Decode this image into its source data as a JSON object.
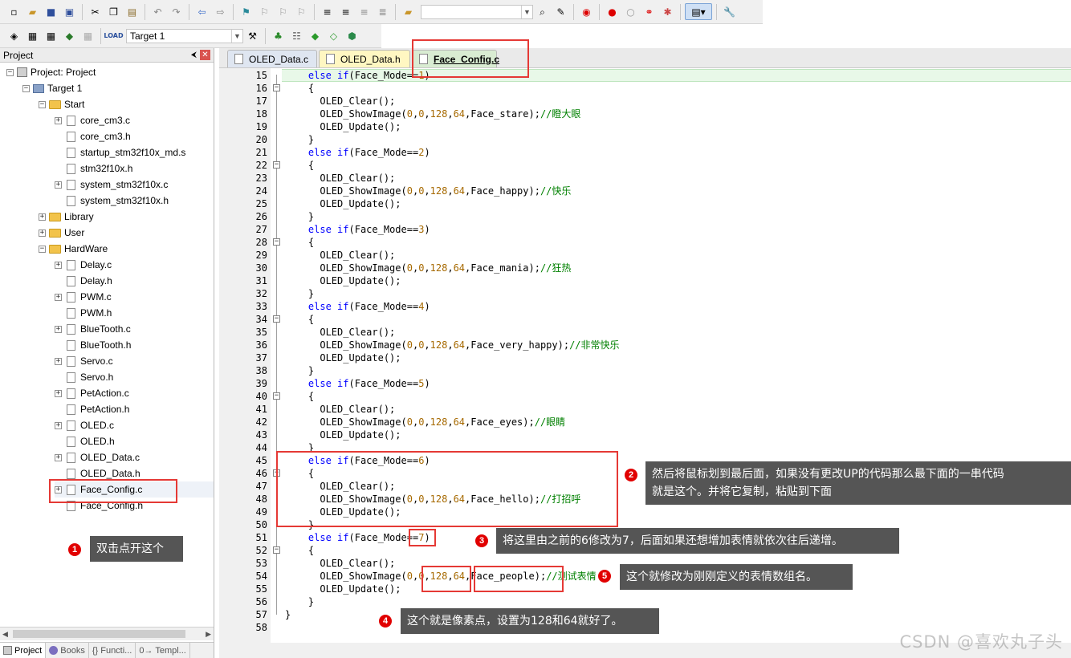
{
  "toolbar": {
    "target_select": "Target 1"
  },
  "project_panel": {
    "title": "Project",
    "pin_glyph": "⮜",
    "close_glyph": "✕",
    "tree": [
      {
        "label": "Project: Project",
        "level": 0,
        "type": "project",
        "expanded": true
      },
      {
        "label": "Target 1",
        "level": 1,
        "type": "target",
        "expanded": true
      },
      {
        "label": "Start",
        "level": 2,
        "type": "folder",
        "expanded": true
      },
      {
        "label": "core_cm3.c",
        "level": 3,
        "type": "file",
        "expandable": true
      },
      {
        "label": "core_cm3.h",
        "level": 3,
        "type": "file",
        "expandable": false
      },
      {
        "label": "startup_stm32f10x_md.s",
        "level": 3,
        "type": "file",
        "expandable": false
      },
      {
        "label": "stm32f10x.h",
        "level": 3,
        "type": "file",
        "expandable": false
      },
      {
        "label": "system_stm32f10x.c",
        "level": 3,
        "type": "file",
        "expandable": true
      },
      {
        "label": "system_stm32f10x.h",
        "level": 3,
        "type": "file",
        "expandable": false
      },
      {
        "label": "Library",
        "level": 2,
        "type": "folder",
        "expanded": false
      },
      {
        "label": "User",
        "level": 2,
        "type": "folder",
        "expanded": false
      },
      {
        "label": "HardWare",
        "level": 2,
        "type": "folder",
        "expanded": true
      },
      {
        "label": "Delay.c",
        "level": 3,
        "type": "file",
        "expandable": true
      },
      {
        "label": "Delay.h",
        "level": 3,
        "type": "file",
        "expandable": false
      },
      {
        "label": "PWM.c",
        "level": 3,
        "type": "file",
        "expandable": true
      },
      {
        "label": "PWM.h",
        "level": 3,
        "type": "file",
        "expandable": false
      },
      {
        "label": "BlueTooth.c",
        "level": 3,
        "type": "file",
        "expandable": true
      },
      {
        "label": "BlueTooth.h",
        "level": 3,
        "type": "file",
        "expandable": false
      },
      {
        "label": "Servo.c",
        "level": 3,
        "type": "file",
        "expandable": true
      },
      {
        "label": "Servo.h",
        "level": 3,
        "type": "file",
        "expandable": false
      },
      {
        "label": "PetAction.c",
        "level": 3,
        "type": "file",
        "expandable": true
      },
      {
        "label": "PetAction.h",
        "level": 3,
        "type": "file",
        "expandable": false
      },
      {
        "label": "OLED.c",
        "level": 3,
        "type": "file",
        "expandable": true
      },
      {
        "label": "OLED.h",
        "level": 3,
        "type": "file",
        "expandable": false
      },
      {
        "label": "OLED_Data.c",
        "level": 3,
        "type": "file",
        "expandable": true
      },
      {
        "label": "OLED_Data.h",
        "level": 3,
        "type": "file",
        "expandable": false
      },
      {
        "label": "Face_Config.c",
        "level": 3,
        "type": "file",
        "expandable": true,
        "selected": true
      },
      {
        "label": "Face_Config.h",
        "level": 3,
        "type": "file",
        "expandable": false
      }
    ],
    "bottom_tabs": [
      "Project",
      "Books",
      "{} Functi...",
      "0→ Templ..."
    ]
  },
  "editor": {
    "tabs": [
      {
        "label": "OLED_Data.c",
        "active": false
      },
      {
        "label": "OLED_Data.h",
        "active": false
      },
      {
        "label": "Face_Config.c",
        "active": true
      }
    ],
    "first_line": 15,
    "lines": [
      "    else if(Face_Mode==1)",
      "    {",
      "      OLED_Clear();",
      "      OLED_ShowImage(0,0,128,64,Face_stare);//瞪大眼",
      "      OLED_Update();",
      "    }",
      "    else if(Face_Mode==2)",
      "    {",
      "      OLED_Clear();",
      "      OLED_ShowImage(0,0,128,64,Face_happy);//快乐",
      "      OLED_Update();",
      "    }",
      "    else if(Face_Mode==3)",
      "    {",
      "      OLED_Clear();",
      "      OLED_ShowImage(0,0,128,64,Face_mania);//狂热",
      "      OLED_Update();",
      "    }",
      "    else if(Face_Mode==4)",
      "    {",
      "      OLED_Clear();",
      "      OLED_ShowImage(0,0,128,64,Face_very_happy);//非常快乐",
      "      OLED_Update();",
      "    }",
      "    else if(Face_Mode==5)",
      "    {",
      "      OLED_Clear();",
      "      OLED_ShowImage(0,0,128,64,Face_eyes);//眼睛",
      "      OLED_Update();",
      "    }",
      "    else if(Face_Mode==6)",
      "    {",
      "      OLED_Clear();",
      "      OLED_ShowImage(0,0,128,64,Face_hello);//打招呼",
      "      OLED_Update();",
      "    }",
      "    else if(Face_Mode==7)",
      "    {",
      "      OLED_Clear();",
      "      OLED_ShowImage(0,0,128,64,Face_people);//测试表情",
      "      OLED_Update();",
      "    }",
      "}",
      ""
    ]
  },
  "annotations": [
    {
      "num": "1",
      "text": "双击点开这个"
    },
    {
      "num": "2",
      "text": "然后将鼠标划到最后面，如果没有更改UP的代码那么最下面的一串代码\n就是这个。并将它复制，粘贴到下面"
    },
    {
      "num": "3",
      "text": "将这里由之前的6修改为7，后面如果还想增加表情就依次往后递增。"
    },
    {
      "num": "4",
      "text": "这个就是像素点，设置为128和64就好了。"
    },
    {
      "num": "5",
      "text": "这个就修改为刚刚定义的表情数组名。"
    }
  ],
  "watermark": "CSDN @喜欢丸子头",
  "colors": {
    "keyword": "#0000ff",
    "number": "#a66900",
    "comment": "#008000",
    "annotation_red": "#e53935",
    "note_bg": "#555555"
  }
}
